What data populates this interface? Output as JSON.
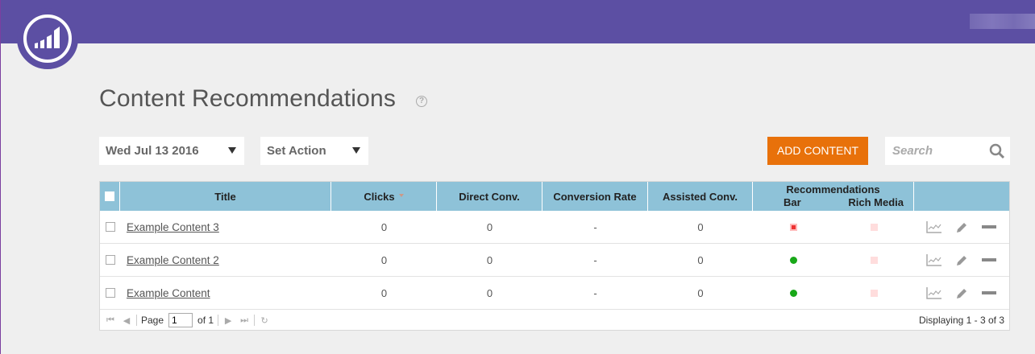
{
  "page": {
    "title": "Content Recommendations"
  },
  "toolbar": {
    "date_value": "Wed Jul 13 2016",
    "set_action_label": "Set Action",
    "add_content_label": "ADD CONTENT",
    "search_placeholder": "Search"
  },
  "grid": {
    "columns": [
      "Title",
      "Clicks",
      "Direct Conv.",
      "Conversion Rate",
      "Assisted Conv."
    ],
    "rec_header": {
      "label": "Recommendations",
      "sub": [
        "Bar",
        "Rich Media"
      ]
    },
    "rows": [
      {
        "title": "Example Content 3",
        "clicks": "0",
        "direct": "0",
        "rate": "-",
        "assisted": "0",
        "bar_status": "red",
        "rich_media_status": "off"
      },
      {
        "title": "Example Content 2",
        "clicks": "0",
        "direct": "0",
        "rate": "-",
        "assisted": "0",
        "bar_status": "green",
        "rich_media_status": "off"
      },
      {
        "title": "Example Content",
        "clicks": "0",
        "direct": "0",
        "rate": "-",
        "assisted": "0",
        "bar_status": "green",
        "rich_media_status": "off"
      }
    ],
    "row_actions": [
      "chart-icon",
      "edit-icon",
      "remove-icon"
    ]
  },
  "pager": {
    "page_label": "Page",
    "page_value": "1",
    "of_label": "of 1",
    "display_text": "Displaying 1 - 3 of 3"
  },
  "colors": {
    "topbar": "#5c4fa3",
    "accent": "#e8710a",
    "grid_header": "#8ec2d8",
    "status_green": "#18a818",
    "status_red": "#ee3333"
  }
}
